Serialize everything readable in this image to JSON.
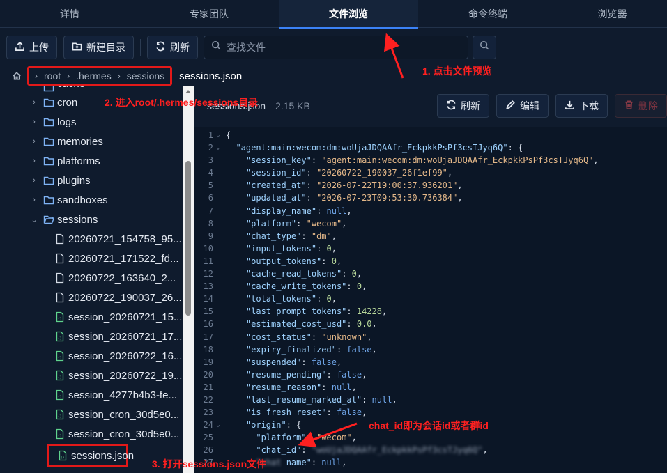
{
  "tabs": [
    {
      "label": "详情"
    },
    {
      "label": "专家团队"
    },
    {
      "label": "文件浏览"
    },
    {
      "label": "命令终端"
    },
    {
      "label": "浏览器"
    }
  ],
  "toolbar": {
    "upload": "上传",
    "new_dir": "新建目录",
    "refresh": "刷新",
    "search_placeholder": "查找文件"
  },
  "breadcrumb": {
    "items": [
      "root",
      ".hermes",
      "sessions"
    ],
    "current_file": "sessions.json"
  },
  "tree": {
    "partial_top": "cache",
    "folders": [
      "cron",
      "logs",
      "memories",
      "platforms",
      "plugins",
      "sandboxes"
    ],
    "open_folder": "sessions",
    "files_plain": [
      "20260721_154758_95...",
      "20260721_171522_fd...",
      "20260722_163640_2...",
      "20260722_190037_26..."
    ],
    "files_json": [
      "session_20260721_15...",
      "session_20260721_17...",
      "session_20260722_16...",
      "session_20260722_19...",
      "session_4277b4b3-fe...",
      "session_cron_30d5e0...",
      "session_cron_30d5e0..."
    ],
    "selected": "sessions.json"
  },
  "editor": {
    "filename": "sessions.json",
    "size": "2.15 KB",
    "refresh": "刷新",
    "edit": "编辑",
    "download": "下载",
    "delete": "删除"
  },
  "code_lines": [
    {
      "n": "1",
      "fold": "⌄",
      "indent": "",
      "parts": [
        [
          "p",
          "{"
        ]
      ]
    },
    {
      "n": "2",
      "fold": "⌄",
      "indent": "  ",
      "parts": [
        [
          "k",
          "\"agent:main:wecom:dm:woUjaJDQAAfr_EckpkkPsPf3csTJyq6Q\""
        ],
        [
          "p",
          ": {"
        ]
      ]
    },
    {
      "n": "3",
      "fold": "",
      "indent": "    ",
      "parts": [
        [
          "k",
          "\"session_key\""
        ],
        [
          "p",
          ": "
        ],
        [
          "s",
          "\"agent:main:wecom:dm:woUjaJDQAAfr_EckpkkPsPf3csTJyq6Q\""
        ],
        [
          "p",
          ","
        ]
      ]
    },
    {
      "n": "4",
      "fold": "",
      "indent": "    ",
      "parts": [
        [
          "k",
          "\"session_id\""
        ],
        [
          "p",
          ": "
        ],
        [
          "s",
          "\"20260722_190037_26f1ef99\""
        ],
        [
          "p",
          ","
        ]
      ]
    },
    {
      "n": "5",
      "fold": "",
      "indent": "    ",
      "parts": [
        [
          "k",
          "\"created_at\""
        ],
        [
          "p",
          ": "
        ],
        [
          "s",
          "\"2026-07-22T19:00:37.936201\""
        ],
        [
          "p",
          ","
        ]
      ]
    },
    {
      "n": "6",
      "fold": "",
      "indent": "    ",
      "parts": [
        [
          "k",
          "\"updated_at\""
        ],
        [
          "p",
          ": "
        ],
        [
          "s",
          "\"2026-07-23T09:53:30.736384\""
        ],
        [
          "p",
          ","
        ]
      ]
    },
    {
      "n": "7",
      "fold": "",
      "indent": "    ",
      "parts": [
        [
          "k",
          "\"display_name\""
        ],
        [
          "p",
          ": "
        ],
        [
          "kw",
          "null"
        ],
        [
          "p",
          ","
        ]
      ]
    },
    {
      "n": "8",
      "fold": "",
      "indent": "    ",
      "parts": [
        [
          "k",
          "\"platform\""
        ],
        [
          "p",
          ": "
        ],
        [
          "s",
          "\"wecom\""
        ],
        [
          "p",
          ","
        ]
      ]
    },
    {
      "n": "9",
      "fold": "",
      "indent": "    ",
      "parts": [
        [
          "k",
          "\"chat_type\""
        ],
        [
          "p",
          ": "
        ],
        [
          "s",
          "\"dm\""
        ],
        [
          "p",
          ","
        ]
      ]
    },
    {
      "n": "10",
      "fold": "",
      "indent": "    ",
      "parts": [
        [
          "k",
          "\"input_tokens\""
        ],
        [
          "p",
          ": "
        ],
        [
          "n",
          "0"
        ],
        [
          "p",
          ","
        ]
      ]
    },
    {
      "n": "11",
      "fold": "",
      "indent": "    ",
      "parts": [
        [
          "k",
          "\"output_tokens\""
        ],
        [
          "p",
          ": "
        ],
        [
          "n",
          "0"
        ],
        [
          "p",
          ","
        ]
      ]
    },
    {
      "n": "12",
      "fold": "",
      "indent": "    ",
      "parts": [
        [
          "k",
          "\"cache_read_tokens\""
        ],
        [
          "p",
          ": "
        ],
        [
          "n",
          "0"
        ],
        [
          "p",
          ","
        ]
      ]
    },
    {
      "n": "13",
      "fold": "",
      "indent": "    ",
      "parts": [
        [
          "k",
          "\"cache_write_tokens\""
        ],
        [
          "p",
          ": "
        ],
        [
          "n",
          "0"
        ],
        [
          "p",
          ","
        ]
      ]
    },
    {
      "n": "14",
      "fold": "",
      "indent": "    ",
      "parts": [
        [
          "k",
          "\"total_tokens\""
        ],
        [
          "p",
          ": "
        ],
        [
          "n",
          "0"
        ],
        [
          "p",
          ","
        ]
      ]
    },
    {
      "n": "15",
      "fold": "",
      "indent": "    ",
      "parts": [
        [
          "k",
          "\"last_prompt_tokens\""
        ],
        [
          "p",
          ": "
        ],
        [
          "n",
          "14228"
        ],
        [
          "p",
          ","
        ]
      ]
    },
    {
      "n": "16",
      "fold": "",
      "indent": "    ",
      "parts": [
        [
          "k",
          "\"estimated_cost_usd\""
        ],
        [
          "p",
          ": "
        ],
        [
          "n",
          "0.0"
        ],
        [
          "p",
          ","
        ]
      ]
    },
    {
      "n": "17",
      "fold": "",
      "indent": "    ",
      "parts": [
        [
          "k",
          "\"cost_status\""
        ],
        [
          "p",
          ": "
        ],
        [
          "s",
          "\"unknown\""
        ],
        [
          "p",
          ","
        ]
      ]
    },
    {
      "n": "18",
      "fold": "",
      "indent": "    ",
      "parts": [
        [
          "k",
          "\"expiry_finalized\""
        ],
        [
          "p",
          ": "
        ],
        [
          "kw",
          "false"
        ],
        [
          "p",
          ","
        ]
      ]
    },
    {
      "n": "19",
      "fold": "",
      "indent": "    ",
      "parts": [
        [
          "k",
          "\"suspended\""
        ],
        [
          "p",
          ": "
        ],
        [
          "kw",
          "false"
        ],
        [
          "p",
          ","
        ]
      ]
    },
    {
      "n": "20",
      "fold": "",
      "indent": "    ",
      "parts": [
        [
          "k",
          "\"resume_pending\""
        ],
        [
          "p",
          ": "
        ],
        [
          "kw",
          "false"
        ],
        [
          "p",
          ","
        ]
      ]
    },
    {
      "n": "21",
      "fold": "",
      "indent": "    ",
      "parts": [
        [
          "k",
          "\"resume_reason\""
        ],
        [
          "p",
          ": "
        ],
        [
          "kw",
          "null"
        ],
        [
          "p",
          ","
        ]
      ]
    },
    {
      "n": "22",
      "fold": "",
      "indent": "    ",
      "parts": [
        [
          "k",
          "\"last_resume_marked_at\""
        ],
        [
          "p",
          ": "
        ],
        [
          "kw",
          "null"
        ],
        [
          "p",
          ","
        ]
      ]
    },
    {
      "n": "23",
      "fold": "",
      "indent": "    ",
      "parts": [
        [
          "k",
          "\"is_fresh_reset\""
        ],
        [
          "p",
          ": "
        ],
        [
          "kw",
          "false"
        ],
        [
          "p",
          ","
        ]
      ]
    },
    {
      "n": "24",
      "fold": "⌄",
      "indent": "    ",
      "parts": [
        [
          "k",
          "\"origin\""
        ],
        [
          "p",
          ": {"
        ]
      ]
    },
    {
      "n": "25",
      "fold": "",
      "indent": "      ",
      "parts": [
        [
          "k",
          "\"platform\""
        ],
        [
          "p",
          ": "
        ],
        [
          "s",
          "\"wecom\""
        ],
        [
          "p",
          ","
        ]
      ]
    },
    {
      "n": "26",
      "fold": "",
      "indent": "      ",
      "parts": [
        [
          "k",
          "\"chat_id\""
        ],
        [
          "p",
          ": "
        ],
        [
          "blur",
          "\"woUjaJDQAAfr_EckpkkPsPf3csTJyq6Q\""
        ],
        [
          "p",
          ","
        ]
      ]
    },
    {
      "n": "27",
      "fold": "",
      "indent": "      ",
      "parts": [
        [
          "blur",
          "\"chat"
        ],
        [
          "k",
          "_name\""
        ],
        [
          "p",
          ": "
        ],
        [
          "kw",
          "null"
        ],
        [
          "p",
          ","
        ]
      ]
    }
  ],
  "annotations": {
    "a1": "1. 点击文件预览",
    "a2": "2. 进入root/.hermes/sessions目录",
    "a3": "3. 打开sessions.json文件",
    "a4": "chat_id即为会话id或者群id"
  },
  "colors": {
    "accent": "#3b82f6",
    "highlight": "#e31919",
    "background": "#0f1b2d"
  }
}
